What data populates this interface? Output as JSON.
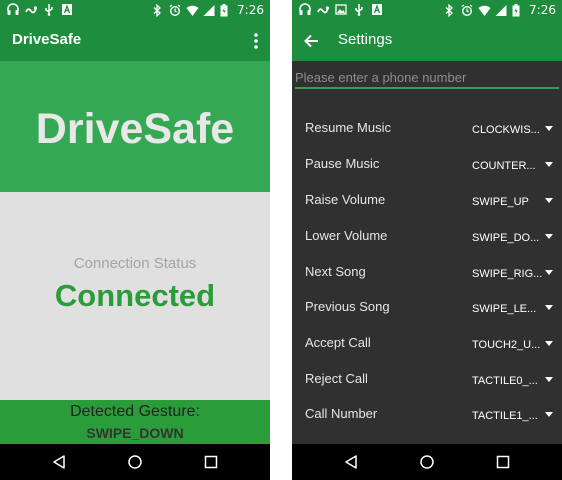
{
  "status_bar": {
    "time": "7:26",
    "left_icons": [
      "headphones-icon",
      "snake-icon",
      "usb-icon",
      "a-icon"
    ],
    "right_icons": [
      "bluetooth-icon",
      "alarm-icon",
      "wifi-icon",
      "signal-icon",
      "battery-icon"
    ]
  },
  "colors": {
    "primary": "#1e8e3e",
    "accent": "#34a853",
    "connected": "#2a9d3a"
  },
  "main_screen": {
    "app_title": "DriveSafe",
    "hero_title": "DriveSafe",
    "connection_label": "Connection Status",
    "connection_value": "Connected",
    "gesture_label": "Detected Gesture:",
    "gesture_value": "SWIPE_DOWN"
  },
  "settings_screen": {
    "title": "Settings",
    "phone_placeholder": "Please enter a phone number",
    "phone_value": "",
    "items": [
      {
        "label": "Resume Music",
        "value": "CLOCKWIS..."
      },
      {
        "label": "Pause Music",
        "value": "COUNTER..."
      },
      {
        "label": "Raise Volume",
        "value": "SWIPE_UP"
      },
      {
        "label": "Lower Volume",
        "value": "SWIPE_DO..."
      },
      {
        "label": "Next Song",
        "value": "SWIPE_RIG..."
      },
      {
        "label": "Previous Song",
        "value": "SWIPE_LE..."
      },
      {
        "label": "Accept Call",
        "value": "TOUCH2_U..."
      },
      {
        "label": "Reject Call",
        "value": "TACTILE0_..."
      },
      {
        "label": "Call Number",
        "value": "TACTILE1_..."
      }
    ]
  },
  "nav_bar": {
    "buttons": [
      "back-icon",
      "home-icon",
      "recents-icon"
    ]
  }
}
